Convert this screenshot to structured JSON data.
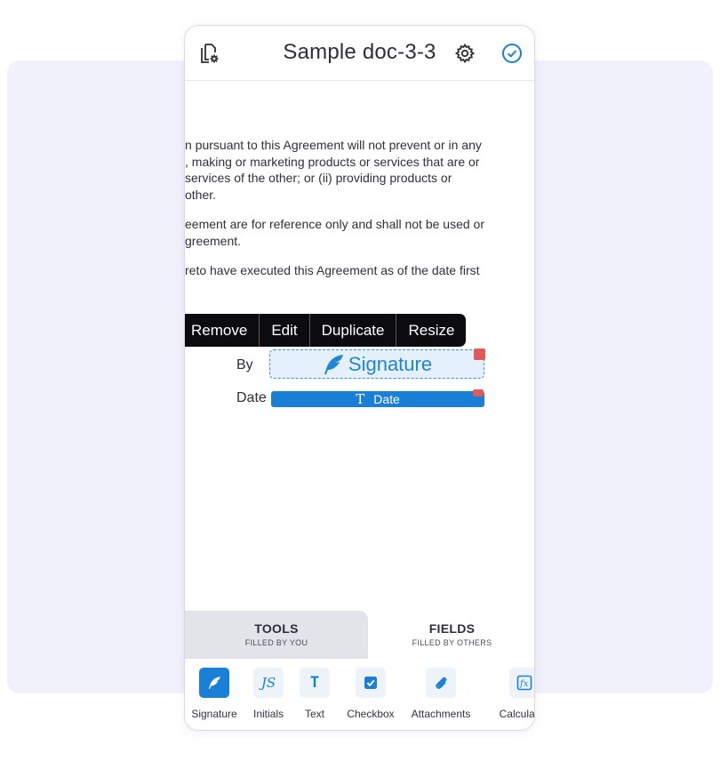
{
  "header": {
    "title": "Sample doc-3-3",
    "left_icon": "document-settings-icon",
    "settings_icon": "gear-icon",
    "done_icon": "check-circle-icon",
    "accent": "#1a7fd6"
  },
  "document": {
    "paragraphs": [
      [
        "n pursuant to this Agreement will not prevent or in any",
        ", making or marketing products or services that are or",
        "services of the other; or (ii) providing products or",
        "other."
      ],
      [
        "eement are for reference only and shall not be used or",
        "greement."
      ],
      [
        "reto have executed this Agreement as of the date first"
      ]
    ],
    "by_label": "By",
    "date_label": "Date"
  },
  "context_menu": {
    "items": [
      "Remove",
      "Edit",
      "Duplicate",
      "Resize"
    ]
  },
  "fields": {
    "signature_label": "Signature",
    "date_label": "Date"
  },
  "tabs": {
    "tools": {
      "title": "TOOLS",
      "subtitle": "FILLED BY YOU"
    },
    "fields": {
      "title": "FIELDS",
      "subtitle": "FILLED BY OTHERS"
    }
  },
  "toolbar": {
    "items": [
      {
        "label": "Signature",
        "icon": "feather-icon"
      },
      {
        "label": "Initials",
        "icon": "initials-icon"
      },
      {
        "label": "Text",
        "icon": "text-icon"
      },
      {
        "label": "Checkbox",
        "icon": "checkbox-icon"
      },
      {
        "label": "Attachments",
        "icon": "paperclip-icon"
      },
      {
        "label": "Calculated",
        "icon": "function-icon"
      }
    ]
  }
}
